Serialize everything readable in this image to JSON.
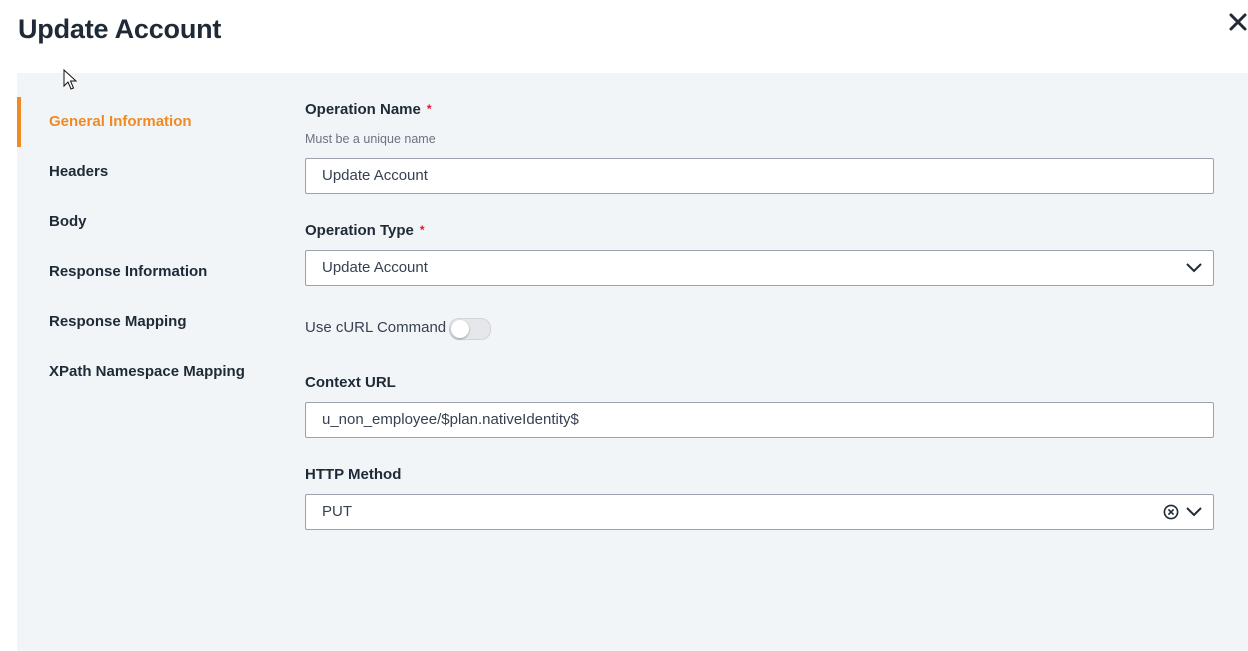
{
  "dialog": {
    "title": "Update Account"
  },
  "nav": {
    "items": [
      {
        "label": "General Information",
        "active": true
      },
      {
        "label": "Headers"
      },
      {
        "label": "Body"
      },
      {
        "label": "Response Information"
      },
      {
        "label": "Response Mapping"
      },
      {
        "label": "XPath Namespace Mapping"
      }
    ]
  },
  "form": {
    "operation_name": {
      "label": "Operation Name",
      "required_mark": "*",
      "helper": "Must be a unique name",
      "value": "Update Account"
    },
    "operation_type": {
      "label": "Operation Type",
      "required_mark": "*",
      "value": "Update Account"
    },
    "curl_toggle": {
      "label": "Use cURL Command",
      "enabled": false
    },
    "context_url": {
      "label": "Context URL",
      "value": "u_non_employee/$plan.nativeIdentity$"
    },
    "http_method": {
      "label": "HTTP Method",
      "value": "PUT"
    }
  },
  "colors": {
    "accent": "#f08a24",
    "required": "#e0102e",
    "panel_bg": "#f2f5f8"
  }
}
